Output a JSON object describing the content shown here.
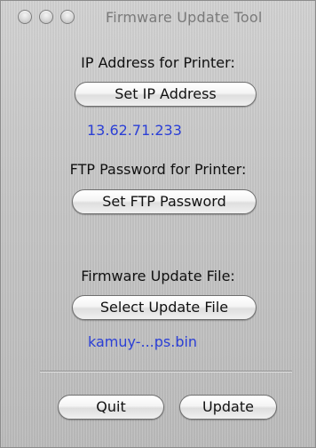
{
  "window": {
    "title": "Firmware Update Tool"
  },
  "ip_section": {
    "label": "IP Address for Printer:",
    "button_label": "Set IP Address",
    "value": "13.62.71.233"
  },
  "ftp_section": {
    "label": "FTP Password for Printer:",
    "button_label": "Set FTP Password"
  },
  "file_section": {
    "label": "Firmware Update File:",
    "button_label": "Select Update File",
    "value": "kamuy-...ps.bin"
  },
  "footer": {
    "quit_label": "Quit",
    "update_label": "Update"
  },
  "colors": {
    "value_text": "#2b3fd6",
    "window_background": "#c6c6c6"
  }
}
